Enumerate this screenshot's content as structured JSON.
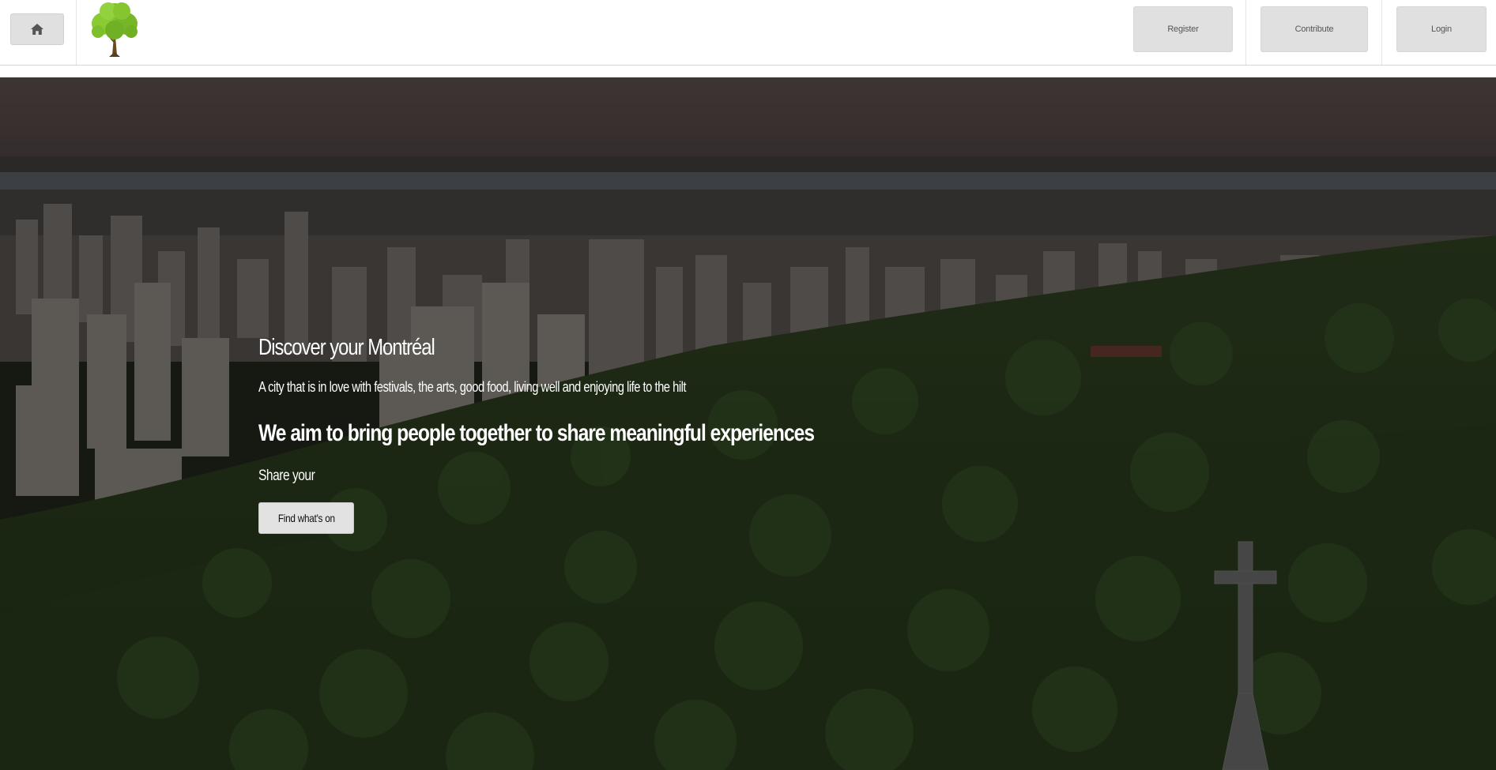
{
  "navbar": {
    "home_icon": "home-icon",
    "logo_icon": "tree-icon",
    "register_label": "Register",
    "contribute_label": "Contribute",
    "login_label": "Login"
  },
  "hero": {
    "title": "Discover your Montréal",
    "subtitle": "A city that is in love with festivals, the arts, good food, living well and enjoying life to the hilt",
    "aim": "We aim to bring people together to share meaningful experiences",
    "share": "Share your",
    "cta_label": "Find what's on",
    "background": "aerial-city-and-forest-photo",
    "landmark_icon": "mount-royal-cross-icon"
  },
  "colors": {
    "button_bg": "#e0e0e0",
    "hero_text": "#ffffff",
    "forest": "#2c3d1f",
    "sky": "#4a4240"
  }
}
